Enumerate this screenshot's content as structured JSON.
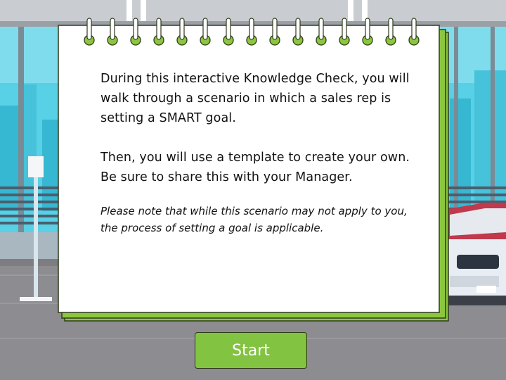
{
  "note": {
    "paragraph1": "During this interactive Knowledge Check, you will walk through a scenario in which a sales rep is setting a SMART goal.",
    "paragraph2": "Then, you will use a template to create your own. Be sure to share this with your Manager.",
    "note_italic": "Please note that while this scenario may not apply to you, the process of setting a goal is applicable."
  },
  "start_button": {
    "label": "Start"
  },
  "colors": {
    "accent_green": "#82c341",
    "window_teal": "#3cc4dc",
    "car_red": "#c0394c",
    "floor_gray": "#8d8c90"
  }
}
